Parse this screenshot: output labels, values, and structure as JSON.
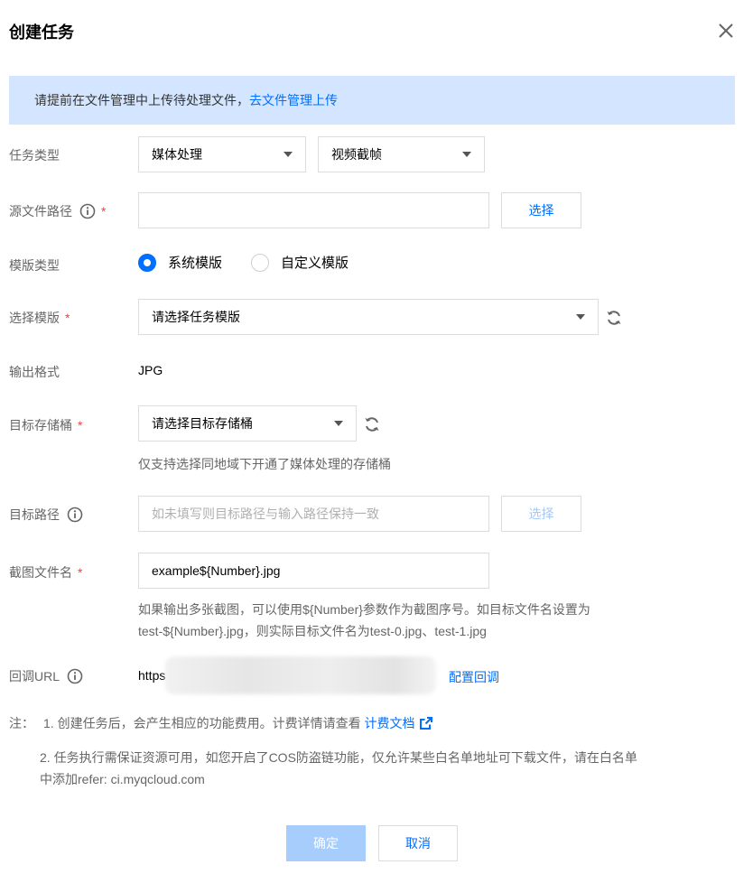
{
  "dialog": {
    "title": "创建任务",
    "close_icon": "close-icon"
  },
  "notice": {
    "text": "请提前在文件管理中上传待处理文件，",
    "link": "去文件管理上传"
  },
  "form": {
    "task_type": {
      "label": "任务类型",
      "value1": "媒体处理",
      "value2": "视频截帧"
    },
    "source_path": {
      "label": "源文件路径",
      "required": "*",
      "value": "",
      "button": "选择"
    },
    "template_type": {
      "label": "模版类型",
      "option1": "系统模版",
      "option2": "自定义模版",
      "selected": "系统模版"
    },
    "template": {
      "label": "选择模版",
      "required": "*",
      "value": "请选择任务模版"
    },
    "output_format": {
      "label": "输出格式",
      "value": "JPG"
    },
    "target_bucket": {
      "label": "目标存储桶",
      "required": "*",
      "value": "请选择目标存储桶",
      "hint": "仅支持选择同地域下开通了媒体处理的存储桶"
    },
    "target_path": {
      "label": "目标路径",
      "placeholder": "如未填写则目标路径与输入路径保持一致",
      "button": "选择"
    },
    "screenshot_filename": {
      "label": "截图文件名",
      "required": "*",
      "value": "example${Number}.jpg",
      "hint1": "如果输出多张截图，可以使用${Number}参数作为截图序号。如目标文件名设置为",
      "hint2": "test-${Number}.jpg，则实际目标文件名为test-0.jpg、test-1.jpg"
    },
    "callback_url": {
      "label": "回调URL",
      "value": "https",
      "link": "配置回调"
    }
  },
  "notes": {
    "prefix": "注：",
    "item1": "1. 创建任务后，会产生相应的功能费用。计费详情请查看",
    "item1_link": "计费文档",
    "item2_line1": "2. 任务执行需保证资源可用，如您开启了COS防盗链功能，仅允许某些白名单地址可下载文件，请在白名单",
    "item2_line2": "中添加refer: ci.myqcloud.com"
  },
  "footer": {
    "ok": "确定",
    "cancel": "取消"
  },
  "colors": {
    "accent": "#006eff",
    "notice_bg": "#d4e6ff",
    "required": "#e54545",
    "disabled_primary": "#a7cdfc"
  }
}
